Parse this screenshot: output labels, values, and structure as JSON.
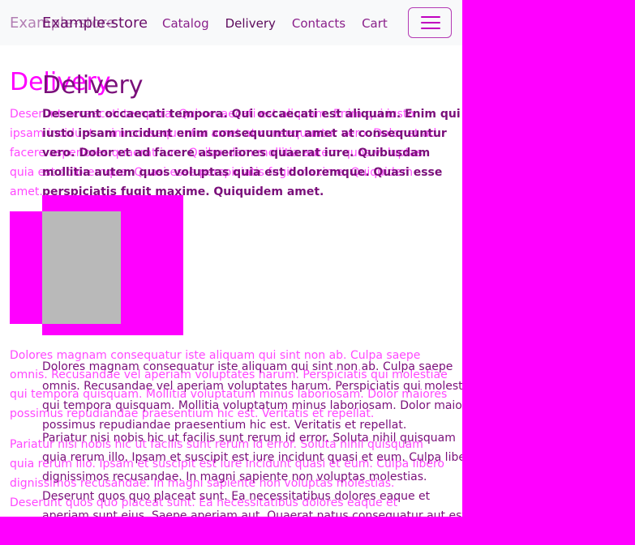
{
  "navbar": {
    "brand": "Example-store",
    "links": [
      "Catalog",
      "Delivery",
      "Contacts",
      "Cart"
    ],
    "active": "Delivery",
    "toggler_icon": "hamburger-icon"
  },
  "page": {
    "title": "Delivery",
    "paragraphs": [
      "Deserunt occaecati tempora. Qui occaecati est aliquam. Enim qui iusto ipsam incidunt enim consequuntur amet at consequuntur vero. Dolor et ad facere asperiores quaerat iure. Quibusdam mollitia autem quos voluptas quia est doloremque. Quasi esse perspiciatis fugit maxime. Quiquidem amet.",
      "Dolores magnam consequatur iste aliquam qui sint non ab. Culpa saepe omnis. Recusandae vel aperiam voluptates harum. Perspiciatis qui molestiae qui tempora quisquam. Mollitia voluptatum minus laboriosam. Dolor maiores possimus repudiandae praesentium hic est. Veritatis et repellat.",
      "Pariatur nisi nobis hic ut facilis sunt rerum id error. Soluta nihil quisquam quia rerum illo. Ipsam et suscipit est iure incidunt quasi et eum. Culpa libero dignissimos recusandae. In magni sapiente non voluptas molestias. Deserunt quos quo placeat sunt. Ea necessitatibus dolores eaque et aperiam sunt eius. Saepe aperiam aut. Quaerat natus consequatur aut est."
    ]
  },
  "colors": {
    "magenta": "#ff00ff",
    "text_purple": "#7a0f7a",
    "white": "#ffffff",
    "image_gray": "#b9b9b9"
  }
}
